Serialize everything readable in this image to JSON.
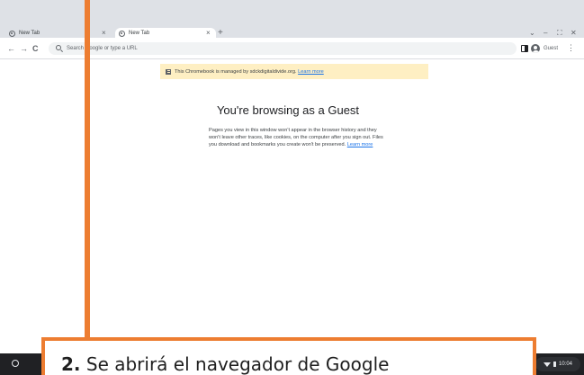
{
  "browser": {
    "tabs": [
      {
        "label": "New Tab",
        "close": "×"
      },
      {
        "label": "New Tab",
        "close": "×"
      }
    ],
    "new_tab_glyph": "+",
    "window_controls": {
      "dropdown": "⌄",
      "minimize": "–",
      "maximize": "⛶",
      "close": "✕"
    },
    "nav": {
      "back": "←",
      "forward": "→",
      "reload": "C"
    },
    "omnibox_placeholder": "Search Google or type a URL",
    "profile_label": "Guest",
    "menu_glyph": "⋮"
  },
  "page": {
    "managed_notice": "This Chromebook is managed by sdckdigitaldivide.org.",
    "managed_link": "Learn more",
    "title": "You're browsing as a Guest",
    "description": "Pages you view in this window won't appear in the browser history and they won't leave other traces, like cookies, on the computer after you sign out. Files you download and bookmarks you create won't be preserved.",
    "description_link": "Learn more"
  },
  "shelf": {
    "time": "10:04"
  },
  "callout": {
    "step": "2.",
    "text": "Se abrirá el navegador de Google"
  },
  "colors": {
    "accent": "#ed7d31",
    "link": "#1a73e8",
    "notice_bg": "#feefc3",
    "shelf_bg": "#202124"
  },
  "icons": [
    "globe-icon",
    "close-icon",
    "plus-icon",
    "back-icon",
    "forward-icon",
    "reload-icon",
    "search-icon",
    "side-panel-icon",
    "guest-avatar-icon",
    "menu-icon",
    "building-icon",
    "launcher-icon",
    "wifi-icon",
    "battery-icon"
  ]
}
